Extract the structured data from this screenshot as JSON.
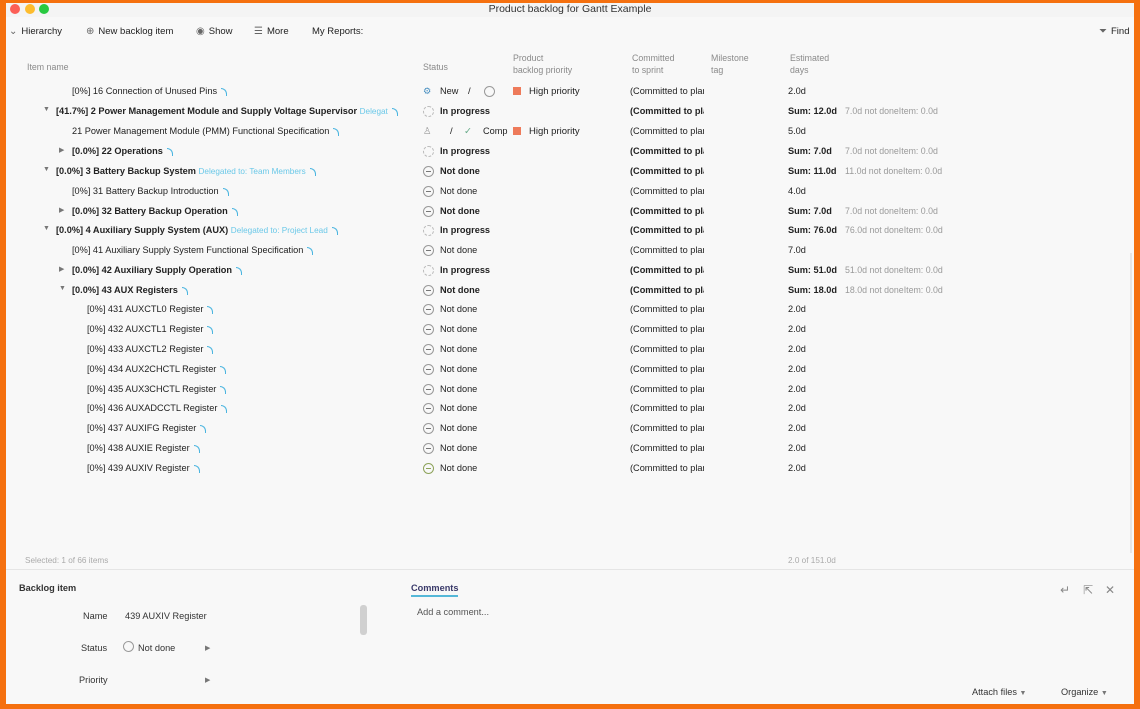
{
  "window": {
    "title": "Product backlog for Gantt Example"
  },
  "toolbar": {
    "hierarchy": "Hierarchy",
    "new_item": "New backlog item",
    "show": "Show",
    "more": "More",
    "reports": "My Reports:",
    "find": "Find"
  },
  "columns": {
    "name": "Item name",
    "status": "Status",
    "priority_1": "Product",
    "priority_2": "backlog priority",
    "committed_1": "Committed",
    "committed_2": "to sprint",
    "milestone_1": "Milestone",
    "milestone_2": "tag",
    "estimated_1": "Estimated",
    "estimated_2": "days"
  },
  "rows": [
    {
      "name": "[0%] 16 Connection of Unused Pins",
      "status_extra": "New",
      "priority": "High priority",
      "commit": "(Committed to planning)",
      "est": "2.0d"
    },
    {
      "name": "[41.7%] 2 Power Management Module and Supply Voltage Supervisor",
      "deleg": "Delegat",
      "status": "In progress",
      "commit": "(Committed to planning)",
      "est": "Sum: 12.0d",
      "extra": "7.0d not doneItem: 0.0d"
    },
    {
      "name": "21 Power Management Module (PMM) Functional Specification",
      "status_extra": "Comp",
      "priority": "High priority",
      "commit": "(Committed to planning)",
      "est": "5.0d"
    },
    {
      "name": "[0.0%] 22 Operations",
      "status": "In progress",
      "commit": "(Committed to planning)",
      "est": "Sum: 7.0d",
      "extra": "7.0d not doneItem: 0.0d"
    },
    {
      "name": "[0.0%] 3 Battery Backup System",
      "deleg": "Delegated to: Team Members",
      "status": "Not done",
      "commit": "(Committed to planning)",
      "est": "Sum: 11.0d",
      "extra": "11.0d not doneItem: 0.0d"
    },
    {
      "name": "[0%] 31 Battery Backup Introduction",
      "status": "Not done",
      "commit": "(Committed to planning)",
      "est": "4.0d"
    },
    {
      "name": "[0.0%] 32 Battery Backup Operation",
      "status": "Not done",
      "commit": "(Committed to planning)",
      "est": "Sum: 7.0d",
      "extra": "7.0d not doneItem: 0.0d"
    },
    {
      "name": "[0.0%] 4 Auxiliary Supply System (AUX)",
      "deleg": "Delegated to: Project Lead",
      "status": "In progress",
      "commit": "(Committed to planning)",
      "est": "Sum: 76.0d",
      "extra": "76.0d not doneItem: 0.0d"
    },
    {
      "name": "[0%] 41 Auxiliary Supply System Functional Specification",
      "status": "Not done",
      "commit": "(Committed to planning)",
      "est": "7.0d"
    },
    {
      "name": "[0.0%] 42 Auxiliary Supply Operation",
      "status": "In progress",
      "commit": "(Committed to planning)",
      "est": "Sum: 51.0d",
      "extra": "51.0d not doneItem: 0.0d"
    },
    {
      "name": "[0.0%] 43 AUX Registers",
      "status": "Not done",
      "commit": "(Committed to planning)",
      "est": "Sum: 18.0d",
      "extra": "18.0d not doneItem: 0.0d"
    },
    {
      "name": "[0%] 431 AUXCTL0 Register",
      "status": "Not done",
      "commit": "(Committed to planning)",
      "est": "2.0d"
    },
    {
      "name": "[0%] 432 AUXCTL1 Register",
      "status": "Not done",
      "commit": "(Committed to planning)",
      "est": "2.0d"
    },
    {
      "name": "[0%] 433 AUXCTL2 Register",
      "status": "Not done",
      "commit": "(Committed to planning)",
      "est": "2.0d"
    },
    {
      "name": "[0%] 434 AUX2CHCTL Register",
      "status": "Not done",
      "commit": "(Committed to planning)",
      "est": "2.0d"
    },
    {
      "name": "[0%] 435 AUX3CHCTL Register",
      "status": "Not done",
      "commit": "(Committed to planning)",
      "est": "2.0d"
    },
    {
      "name": "[0%] 436 AUXADCCTL Register",
      "status": "Not done",
      "commit": "(Committed to planning)",
      "est": "2.0d"
    },
    {
      "name": "[0%] 437 AUXIFG Register",
      "status": "Not done",
      "commit": "(Committed to planning)",
      "est": "2.0d"
    },
    {
      "name": "[0%] 438 AUXIE Register",
      "status": "Not done",
      "commit": "(Committed to planning)",
      "est": "2.0d"
    },
    {
      "name": "[0%] 439 AUXIV Register",
      "status": "Not done",
      "commit": "(Committed to planning)",
      "est": "2.0d"
    }
  ],
  "footer": {
    "selected": "Selected: 1 of 66 items",
    "total": "2.0 of 151.0d"
  },
  "details": {
    "title": "Backlog item",
    "name_label": "Name",
    "name_value": "439 AUXIV Register",
    "status_label": "Status",
    "status_value": "Not done",
    "priority_label": "Priority"
  },
  "comments": {
    "tab": "Comments",
    "placeholder": "Add a comment...",
    "attach": "Attach files",
    "organize": "Organize"
  },
  "colors": {
    "frame": "#f5700f",
    "accent": "#55b8d8",
    "priority": "#ee7a5a"
  }
}
